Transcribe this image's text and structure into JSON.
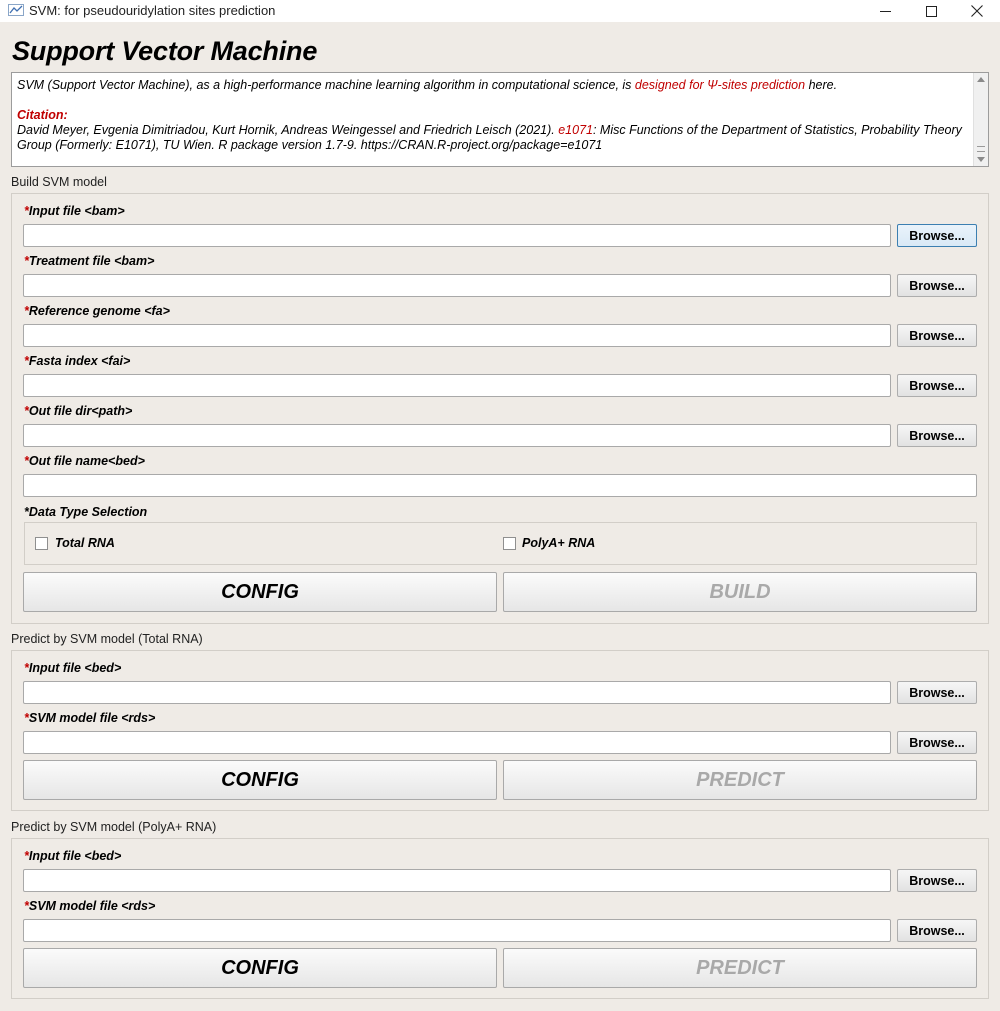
{
  "window": {
    "title": "SVM: for pseudouridylation sites prediction"
  },
  "heading": "Support Vector Machine",
  "info": {
    "intro_before": "SVM (Support Vector Machine), as a high-performance machine learning algorithm in computational science, is ",
    "intro_highlight": "designed for Ψ-sites prediction",
    "intro_after": " here.",
    "citation_label": "Citation:",
    "citation_before": "David Meyer, Evgenia Dimitriadou, Kurt Hornik, Andreas Weingessel and Friedrich Leisch (2021). ",
    "citation_highlight": "e1071",
    "citation_after": ": Misc Functions of the Department of Statistics, Probability Theory Group (Formerly: E1071), TU Wien. R package version 1.7-9. https://CRAN.R-project.org/package=e1071"
  },
  "build": {
    "section_title": "Build SVM model",
    "fields": [
      {
        "label": "Input file <bam>",
        "value": ""
      },
      {
        "label": "Treatment file <bam>",
        "value": ""
      },
      {
        "label": "Reference genome <fa>",
        "value": ""
      },
      {
        "label": "Fasta index <fai>",
        "value": ""
      },
      {
        "label": "Out file dir<path>",
        "value": ""
      },
      {
        "label": "Out file name<bed>",
        "value": ""
      }
    ],
    "data_type_label": "*Data Type Selection",
    "options": [
      "Total RNA",
      "PolyA+ RNA"
    ],
    "config_label": "CONFIG",
    "build_label": "BUILD"
  },
  "predict_total": {
    "section_title": "Predict by SVM model (Total RNA)",
    "fields": [
      {
        "label": "Input file <bed>",
        "value": ""
      },
      {
        "label": "SVM model file <rds>",
        "value": ""
      }
    ],
    "config_label": "CONFIG",
    "predict_label": "PREDICT"
  },
  "predict_polya": {
    "section_title": "Predict by SVM model (PolyA+ RNA)",
    "fields": [
      {
        "label": "Input file <bed>",
        "value": ""
      },
      {
        "label": "SVM model file <rds>",
        "value": ""
      }
    ],
    "config_label": "CONFIG",
    "predict_label": "PREDICT"
  },
  "common": {
    "required_mark": "*",
    "browse_label": "Browse..."
  },
  "colors": {
    "accent_red": "#c00000",
    "window_bg": "#efebe6"
  },
  "icons": [
    "app-icon",
    "minimize-icon",
    "maximize-icon",
    "close-icon",
    "scroll-up-icon",
    "scroll-down-icon"
  ]
}
